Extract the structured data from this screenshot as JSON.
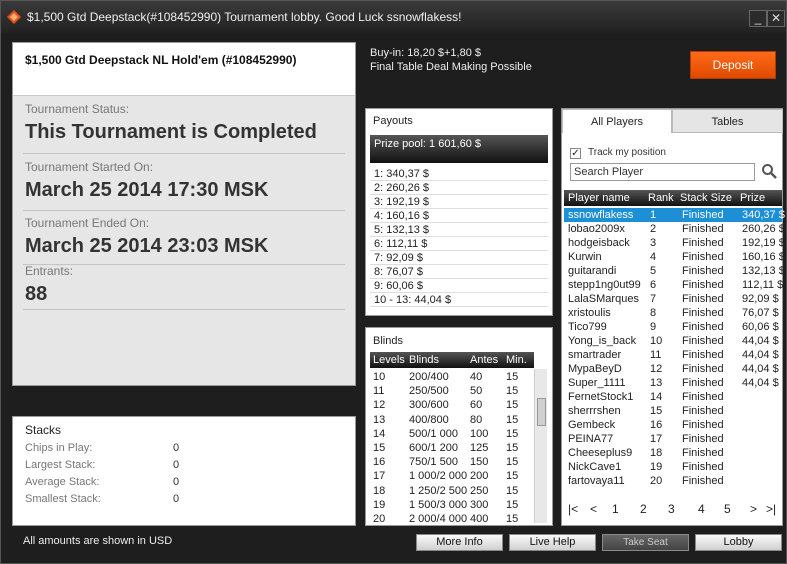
{
  "window": {
    "title": "$1,500 Gtd Deepstack(#108452990) Tournament lobby. Good Luck ssnowflakess!",
    "minimize": "_",
    "restore": "□",
    "close": "✕"
  },
  "info": {
    "name": "$1,500 Gtd Deepstack NL Hold'em (#108452990)",
    "status_label": "Tournament Status:",
    "status_value": "This Tournament is Completed",
    "started_label": "Tournament Started On:",
    "started_value": "March 25 2014  17:30 MSK",
    "ended_label": "Tournament Ended On:",
    "ended_value": "March 25 2014  23:03 MSK",
    "entrants_label": "Entrants:",
    "entrants_value": "88"
  },
  "stacks": {
    "title": "Stacks",
    "rows": [
      {
        "label": "Chips in Play:",
        "value": "0"
      },
      {
        "label": "Largest Stack:",
        "value": "0"
      },
      {
        "label": "Average Stack:",
        "value": "0"
      },
      {
        "label": "Smallest Stack:",
        "value": "0"
      }
    ]
  },
  "footnote": "All amounts are shown in USD",
  "buyin": {
    "line1": "Buy-in: 18,20 $+1,80 $",
    "line2": "Final Table Deal Making Possible"
  },
  "deposit_label": "Deposit",
  "payouts": {
    "title": "Payouts",
    "pool": "Prize pool: 1 601,60 $",
    "rows": [
      "1: 340,37 $",
      "2: 260,26 $",
      "3: 192,19 $",
      "4: 160,16 $",
      "5: 132,13 $",
      "6: 112,11 $",
      "7: 92,09 $",
      "8: 76,07 $",
      "9: 60,06 $",
      "10 - 13: 44,04 $"
    ]
  },
  "blinds": {
    "title": "Blinds",
    "headers": [
      "Levels",
      "Blinds",
      "Antes",
      "Min."
    ],
    "rows": [
      [
        "10",
        "200/400",
        "40",
        "15"
      ],
      [
        "11",
        "250/500",
        "50",
        "15"
      ],
      [
        "12",
        "300/600",
        "60",
        "15"
      ],
      [
        "13",
        "400/800",
        "80",
        "15"
      ],
      [
        "14",
        "500/1 000",
        "100",
        "15"
      ],
      [
        "15",
        "600/1 200",
        "125",
        "15"
      ],
      [
        "16",
        "750/1 500",
        "150",
        "15"
      ],
      [
        "17",
        "1 000/2 000",
        "200",
        "15"
      ],
      [
        "18",
        "1 250/2 500",
        "250",
        "15"
      ],
      [
        "19",
        "1 500/3 000",
        "300",
        "15"
      ],
      [
        "20",
        "2 000/4 000",
        "400",
        "15"
      ]
    ]
  },
  "players": {
    "tabs": [
      "All Players",
      "Tables"
    ],
    "track_label": "Track my position",
    "search_placeholder": "Search Player",
    "headers": [
      "Player name",
      "Rank",
      "Stack Size",
      "Prize"
    ],
    "rows": [
      [
        "ssnowflakess",
        "1",
        "Finished",
        "340,37 $"
      ],
      [
        "lobao2009x",
        "2",
        "Finished",
        "260,26 $"
      ],
      [
        "hodgeisback",
        "3",
        "Finished",
        "192,19 $"
      ],
      [
        "Kurwin",
        "4",
        "Finished",
        "160,16 $"
      ],
      [
        "guitarandi",
        "5",
        "Finished",
        "132,13 $"
      ],
      [
        "stepp1ng0ut99",
        "6",
        "Finished",
        "112,11 $"
      ],
      [
        "LalaSMarques",
        "7",
        "Finished",
        "92,09 $"
      ],
      [
        "xristoulis",
        "8",
        "Finished",
        "76,07 $"
      ],
      [
        "Tico799",
        "9",
        "Finished",
        "60,06 $"
      ],
      [
        "Yong_is_back",
        "10",
        "Finished",
        "44,04 $"
      ],
      [
        "smartrader",
        "11",
        "Finished",
        "44,04 $"
      ],
      [
        "MypaBeyD",
        "12",
        "Finished",
        "44,04 $"
      ],
      [
        "Super_1111",
        "13",
        "Finished",
        "44,04 $"
      ],
      [
        "FernetStock1",
        "14",
        "Finished",
        ""
      ],
      [
        "sherrrshen",
        "15",
        "Finished",
        ""
      ],
      [
        "Gembeck",
        "16",
        "Finished",
        ""
      ],
      [
        "PEINA77",
        "17",
        "Finished",
        ""
      ],
      [
        "Cheeseplus9",
        "18",
        "Finished",
        ""
      ],
      [
        "NickCave1",
        "19",
        "Finished",
        ""
      ],
      [
        "fartovaya11",
        "20",
        "Finished",
        ""
      ]
    ],
    "pages": [
      "1",
      "2",
      "3",
      "4",
      "5"
    ]
  },
  "buttons": {
    "more_info": "More Info",
    "live_help": "Live Help",
    "take_seat": "Take Seat",
    "lobby": "Lobby"
  },
  "colors": {
    "accent": "#ff6a1a",
    "selection": "#1c8fd6"
  }
}
